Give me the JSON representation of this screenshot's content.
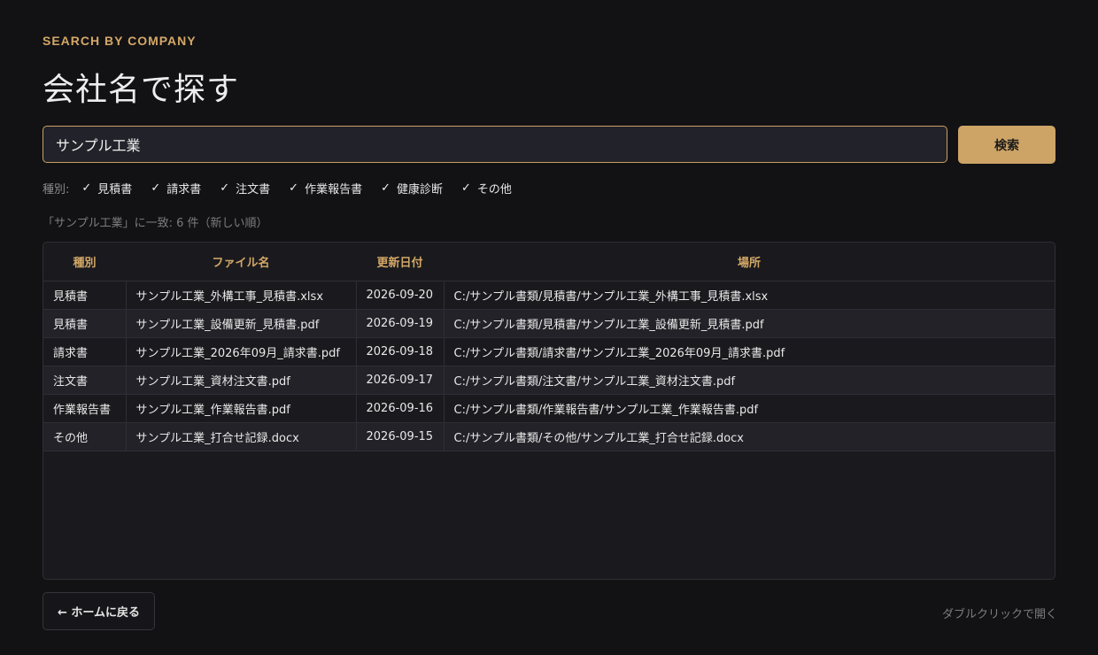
{
  "header": {
    "eyebrow": "SEARCH BY COMPANY",
    "title": "会社名で探す"
  },
  "search": {
    "value": "サンプル工業",
    "button_label": "検索"
  },
  "filters": {
    "label": "種別:",
    "options": [
      {
        "label": "見積書",
        "checked": true
      },
      {
        "label": "請求書",
        "checked": true
      },
      {
        "label": "注文書",
        "checked": true
      },
      {
        "label": "作業報告書",
        "checked": true
      },
      {
        "label": "健康診断",
        "checked": true
      },
      {
        "label": "その他",
        "checked": true
      }
    ],
    "check_glyph": "✓"
  },
  "result_summary": "「サンプル工業」に一致: 6 件（新しい順）",
  "table": {
    "columns": [
      "種別",
      "ファイル名",
      "更新日付",
      "場所"
    ],
    "rows": [
      [
        "見積書",
        "サンプル工業_外構工事_見積書.xlsx",
        "2026-09-20",
        "C:/サンプル書類/見積書/サンプル工業_外構工事_見積書.xlsx"
      ],
      [
        "見積書",
        "サンプル工業_設備更新_見積書.pdf",
        "2026-09-19",
        "C:/サンプル書類/見積書/サンプル工業_設備更新_見積書.pdf"
      ],
      [
        "請求書",
        "サンプル工業_2026年09月_請求書.pdf",
        "2026-09-18",
        "C:/サンプル書類/請求書/サンプル工業_2026年09月_請求書.pdf"
      ],
      [
        "注文書",
        "サンプル工業_資材注文書.pdf",
        "2026-09-17",
        "C:/サンプル書類/注文書/サンプル工業_資材注文書.pdf"
      ],
      [
        "作業報告書",
        "サンプル工業_作業報告書.pdf",
        "2026-09-16",
        "C:/サンプル書類/作業報告書/サンプル工業_作業報告書.pdf"
      ],
      [
        "その他",
        "サンプル工業_打合せ記録.docx",
        "2026-09-15",
        "C:/サンプル書類/その他/サンプル工業_打合せ記録.docx"
      ]
    ]
  },
  "footer": {
    "back_label": "← ホームに戻る",
    "hint": "ダブルクリックで開く"
  },
  "colors": {
    "accent": "#cda466",
    "background": "#121215"
  }
}
